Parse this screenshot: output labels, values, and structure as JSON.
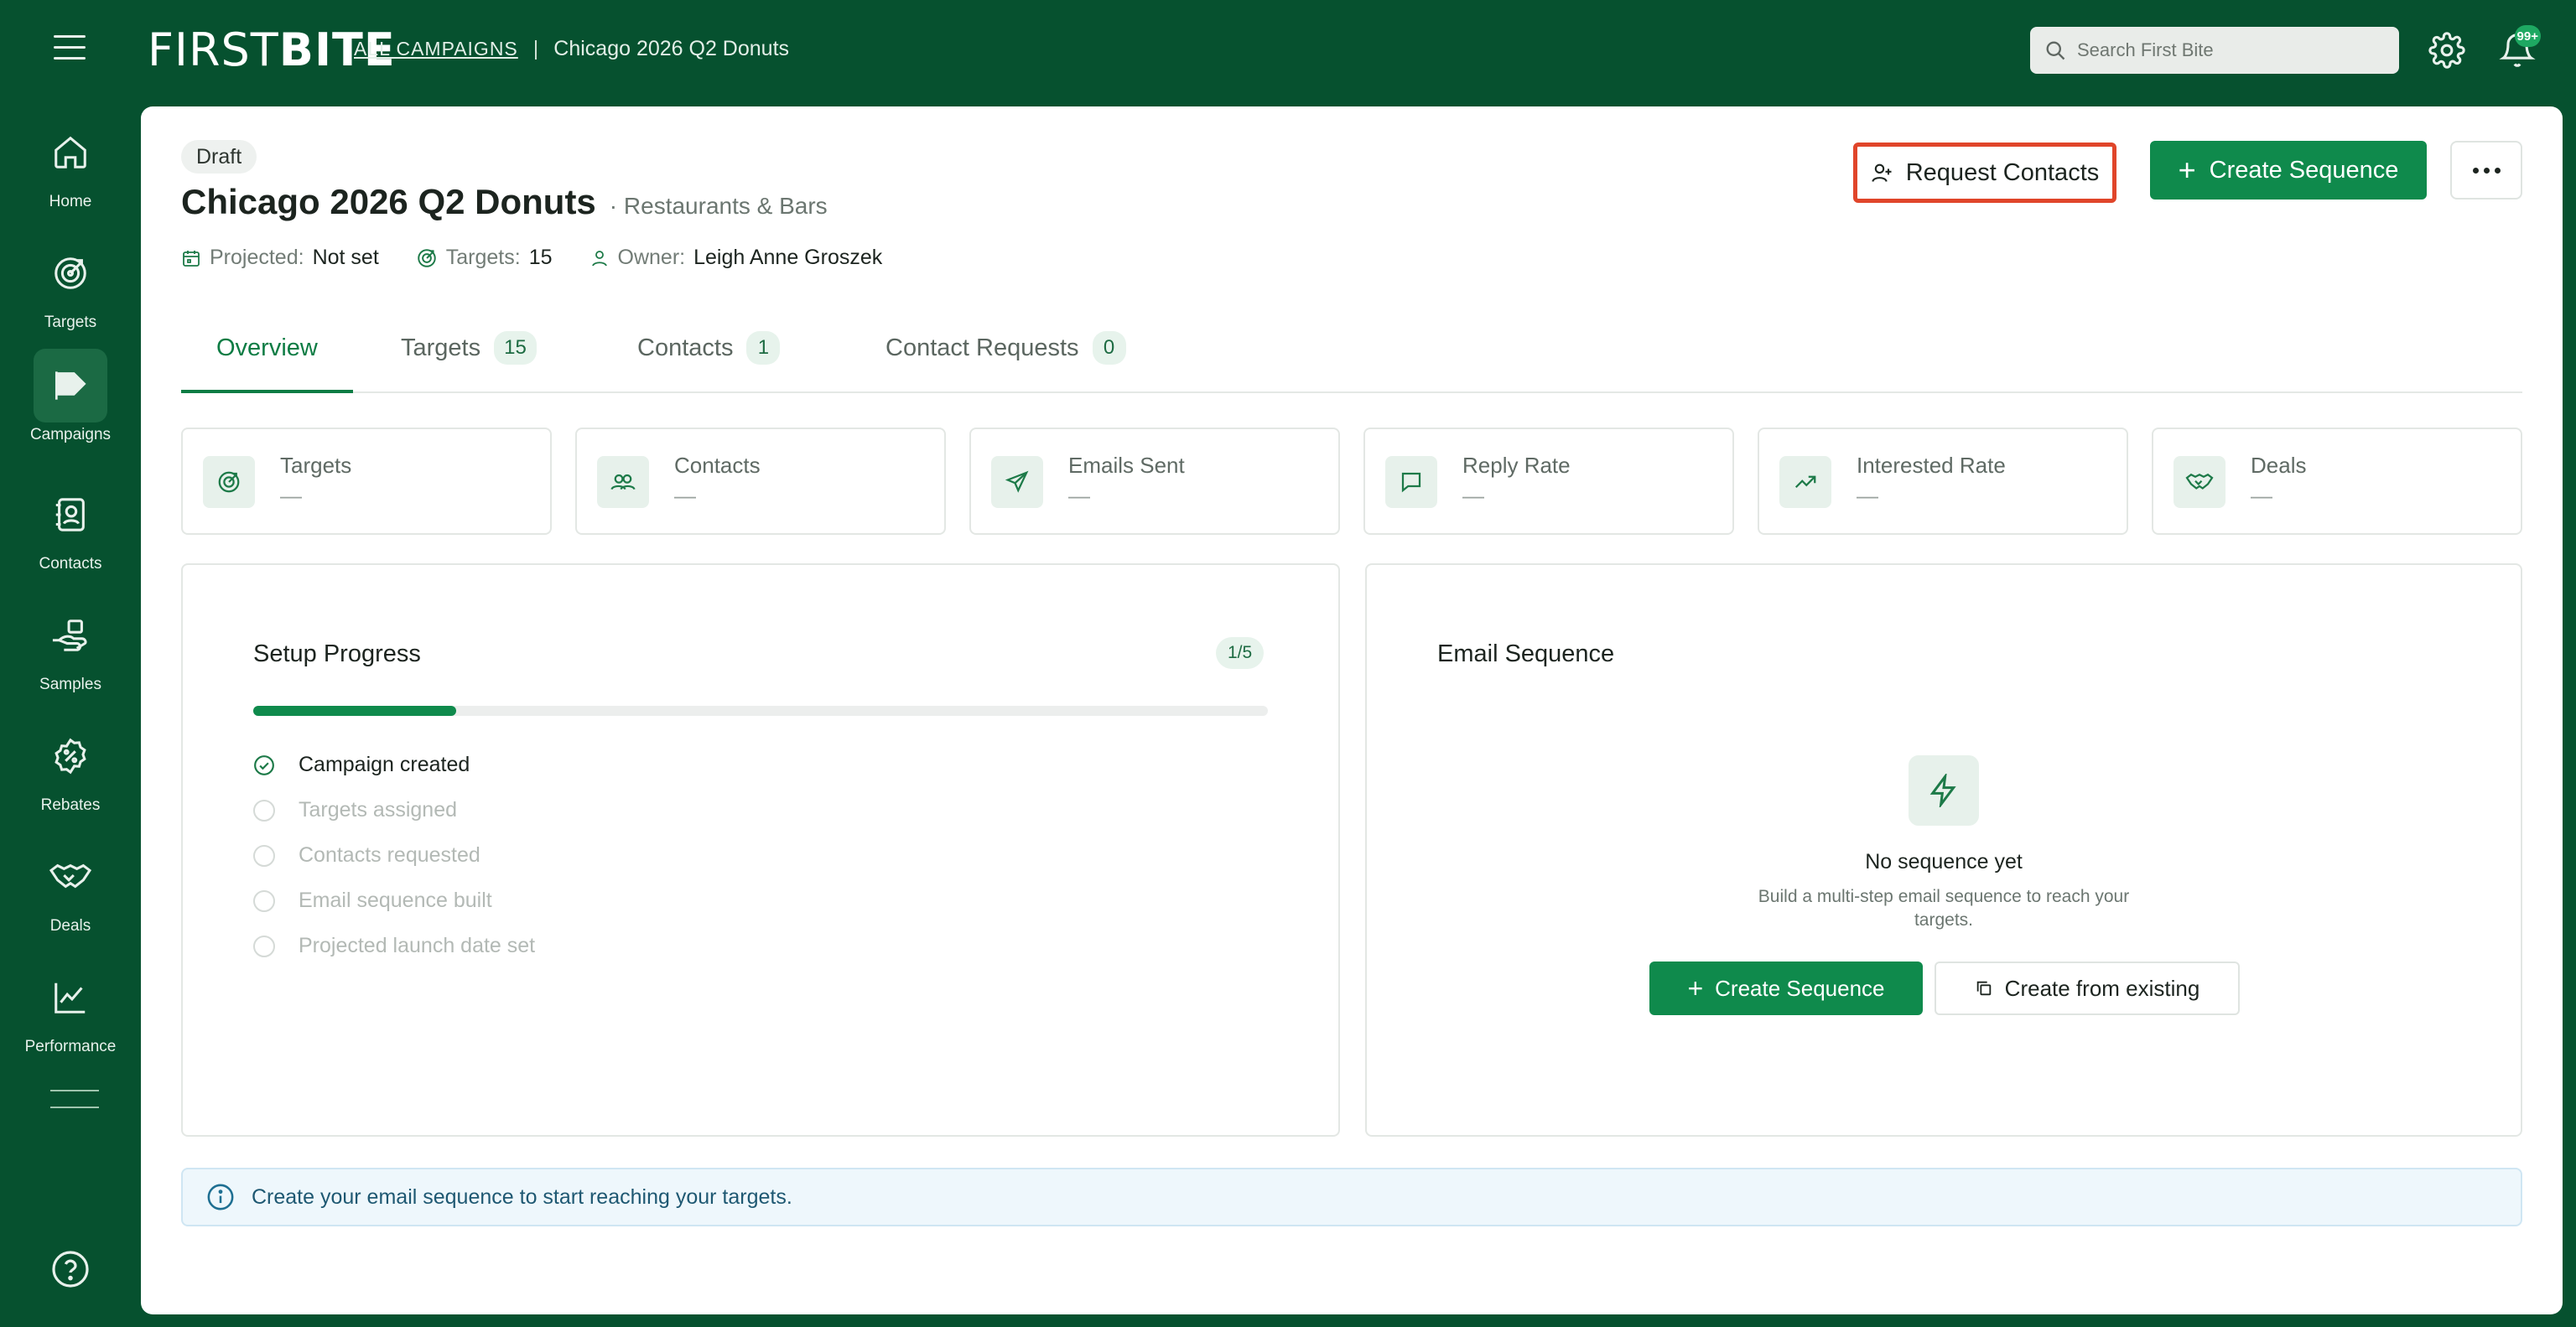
{
  "header": {
    "logo_light": "FIRST",
    "logo_bold": "BITE",
    "breadcrumb_link": "ALL CAMPAIGNS",
    "breadcrumb_sep": "|",
    "breadcrumb_current": "Chicago 2026 Q2 Donuts",
    "search_placeholder": "Search First Bite",
    "notification_badge": "99+"
  },
  "sidebar": {
    "items": [
      {
        "label": "Home",
        "icon": "home-icon"
      },
      {
        "label": "Targets",
        "icon": "target-icon"
      },
      {
        "label": "Campaigns",
        "icon": "megaphone-icon",
        "active": true
      },
      {
        "label": "Contacts",
        "icon": "contact-book-icon"
      },
      {
        "label": "Samples",
        "icon": "hand-box-icon"
      },
      {
        "label": "Rebates",
        "icon": "percent-badge-icon"
      },
      {
        "label": "Deals",
        "icon": "handshake-icon"
      },
      {
        "label": "Performance",
        "icon": "trend-chart-icon"
      }
    ]
  },
  "campaign": {
    "status": "Draft",
    "title": "Chicago 2026 Q2 Donuts",
    "category": "· Restaurants & Bars",
    "projected_label": "Projected:",
    "projected_value": "Not set",
    "targets_label": "Targets:",
    "targets_value": "15",
    "owner_label": "Owner:",
    "owner_value": "Leigh Anne Groszek"
  },
  "actions": {
    "request_contacts": "Request Contacts",
    "create_sequence": "Create Sequence"
  },
  "tabs": [
    {
      "label": "Overview",
      "count": null,
      "active": true
    },
    {
      "label": "Targets",
      "count": "15"
    },
    {
      "label": "Contacts",
      "count": "1"
    },
    {
      "label": "Contact Requests",
      "count": "0"
    }
  ],
  "stats": [
    {
      "label": "Targets",
      "value": "—",
      "icon": "target-icon"
    },
    {
      "label": "Contacts",
      "value": "—",
      "icon": "users-icon"
    },
    {
      "label": "Emails Sent",
      "value": "—",
      "icon": "send-icon"
    },
    {
      "label": "Reply Rate",
      "value": "—",
      "icon": "message-icon"
    },
    {
      "label": "Interested Rate",
      "value": "—",
      "icon": "trending-up-icon"
    },
    {
      "label": "Deals",
      "value": "—",
      "icon": "handshake-icon"
    }
  ],
  "setup": {
    "title": "Setup Progress",
    "fraction": "1/5",
    "progress": 0.2,
    "steps": [
      {
        "label": "Campaign created",
        "done": true
      },
      {
        "label": "Targets assigned",
        "done": false
      },
      {
        "label": "Contacts requested",
        "done": false
      },
      {
        "label": "Email sequence built",
        "done": false
      },
      {
        "label": "Projected launch date set",
        "done": false
      }
    ]
  },
  "email_sequence": {
    "title": "Email Sequence",
    "empty_title": "No sequence yet",
    "empty_sub": "Build a multi-step email sequence to reach your targets.",
    "create_label": "Create Sequence",
    "existing_label": "Create from existing"
  },
  "info": {
    "message": "Create your email sequence to start reaching your targets."
  },
  "colors": {
    "brand_dark": "#06512f",
    "accent_green": "#0f8a4c",
    "highlight_red": "#e0452a"
  }
}
